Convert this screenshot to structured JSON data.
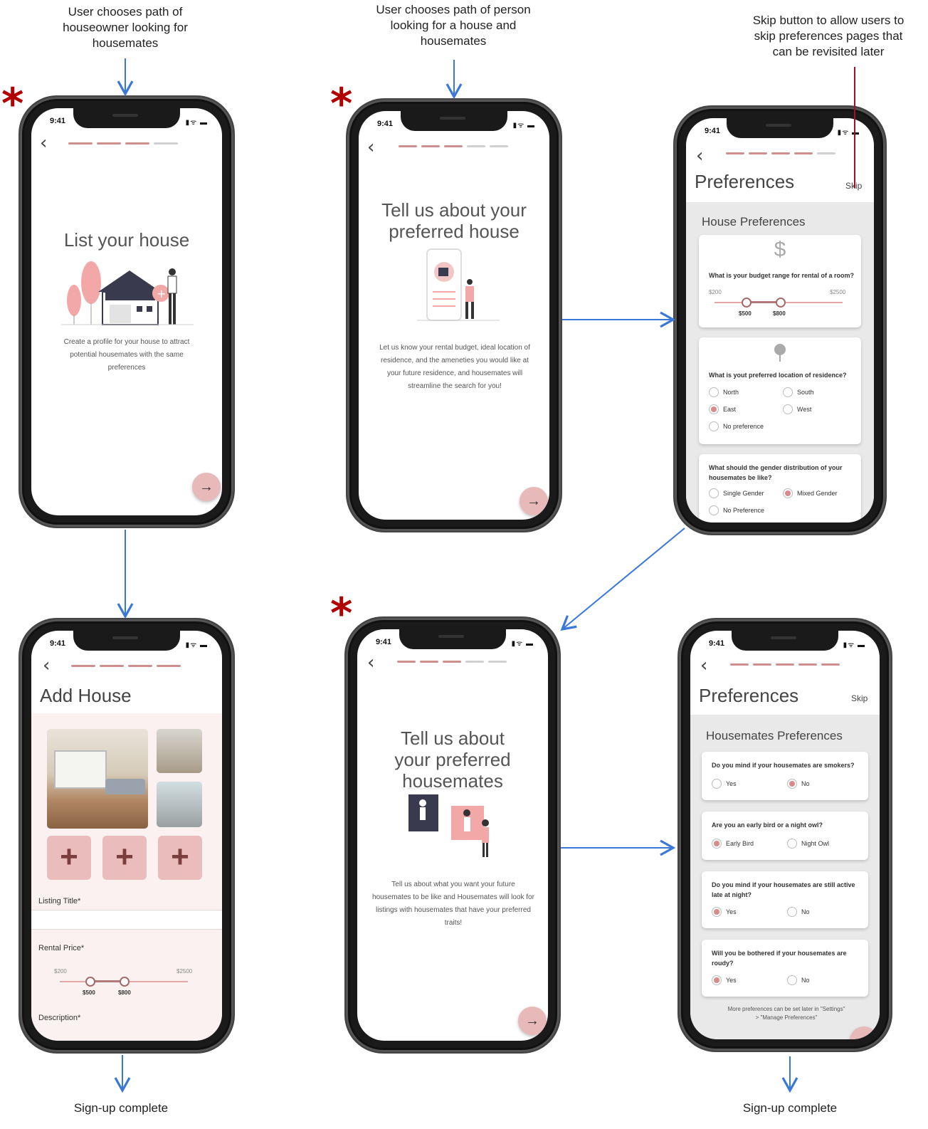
{
  "captions": {
    "owner_path": "User chooses path of houseowner looking for housemates",
    "seeker_path": "User chooses path of person looking for a house and housemates",
    "skip_note": "Skip button to allow users to skip preferences pages that can be revisited later",
    "signup_left": "Sign-up complete",
    "signup_right": "Sign-up complete"
  },
  "star_symbol": "*",
  "status": {
    "time": "9:41",
    "icons": "▮ᯤ ▬"
  },
  "back_glyph": "‹",
  "next_glyph": "→",
  "screen_list_house": {
    "title": "List your house",
    "description": "Create a profile for your house to attract potential housemates with the same preferences",
    "progress": [
      true,
      true,
      true,
      false
    ]
  },
  "screen_add_house": {
    "title": "Add House",
    "plus": "+",
    "listing_title_label": "Listing Title*",
    "rental_price_label": "Rental Price*",
    "min": "$200",
    "max": "$2500",
    "low": "$500",
    "high": "$800",
    "description_label": "Description*",
    "progress": [
      true,
      true,
      true,
      true
    ]
  },
  "screen_pref_house_intro": {
    "title": "Tell us about your preferred house",
    "description": "Let us know your rental budget, ideal location of residence, and the ameneties you would like at your future residence, and housemates will streamline the search for you!",
    "progress": [
      true,
      true,
      true,
      false,
      false
    ]
  },
  "screen_house_prefs": {
    "title": "Preferences",
    "skip": "Skip",
    "section": "House Preferences",
    "dollar": "$",
    "budget_q": "What is your budget range for rental of a room?",
    "min": "$200",
    "max": "$2500",
    "low": "$500",
    "high": "$800",
    "location_q": "What is yout preferred location of residence?",
    "loc_north": "North",
    "loc_south": "South",
    "loc_east": "East",
    "loc_west": "West",
    "loc_none": "No preference",
    "gender_q": "What should the gender distribution of your housemates be like?",
    "g_single": "Single Gender",
    "g_mixed": "Mixed Gender",
    "g_none": "No Preference",
    "progress": [
      true,
      true,
      true,
      true,
      false
    ]
  },
  "screen_housemate_intro": {
    "title": "Tell us about your preferred housemates",
    "description": "Tell us about what you want your future housemates to be like and Housemates will look for listings with housemates that have your preferred traits!",
    "progress": [
      true,
      true,
      true,
      false,
      false
    ]
  },
  "screen_housemate_prefs": {
    "title": "Preferences",
    "skip": "Skip",
    "section": "Housemates Preferences",
    "q1": "Do you mind if your housemates are smokers?",
    "q2": "Are you an early bird or a night owl?",
    "q3": "Do you mind if your housemates are still active late at night?",
    "q4": "Will you be bothered if your housemates are roudy?",
    "yes": "Yes",
    "no": "No",
    "early": "Early Bird",
    "night": "Night Owl",
    "footer": "More preferences can be set later in \"Settings\" > \"Manage Preferences\"",
    "progress": [
      true,
      true,
      true,
      true,
      true
    ]
  },
  "colors": {
    "accent": "#e8b9b9",
    "progress_on": "#cf8f8f",
    "arrow": "#3a78d8",
    "skip_line": "#a0102a",
    "star": "#b00000"
  }
}
